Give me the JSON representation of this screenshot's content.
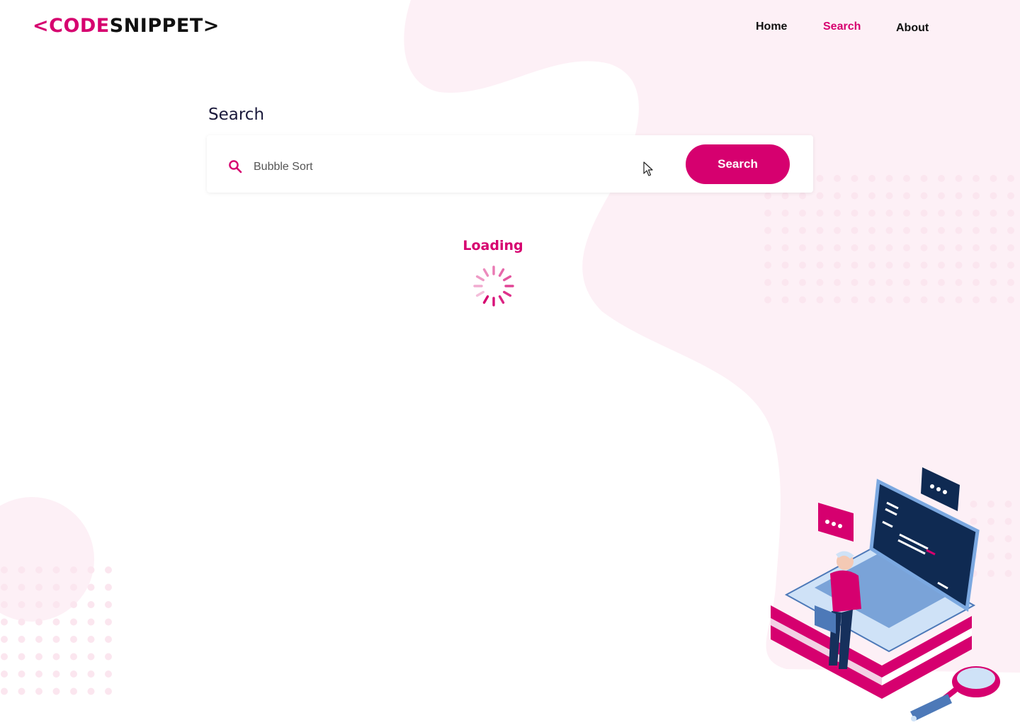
{
  "brand": {
    "logo_open": "<",
    "logo_code": "CODE",
    "logo_snippet": "SNIPPET",
    "logo_close": ">",
    "accent_color": "#d6006f",
    "dark_color": "#1b1a3c",
    "blob_color": "#fdf0f6"
  },
  "nav": {
    "items": [
      {
        "label": "Home",
        "active": false
      },
      {
        "label": "Search",
        "active": true
      },
      {
        "label": "About",
        "active": false
      }
    ]
  },
  "search": {
    "title": "Search",
    "input_value": "Bubble Sort",
    "placeholder": "Search",
    "button_label": "Search",
    "icon": "search-icon"
  },
  "status": {
    "loading_label": "Loading",
    "spinner_icon": "spinner-icon"
  },
  "illustration": {
    "icon": "developer-on-laptop-illustration"
  }
}
